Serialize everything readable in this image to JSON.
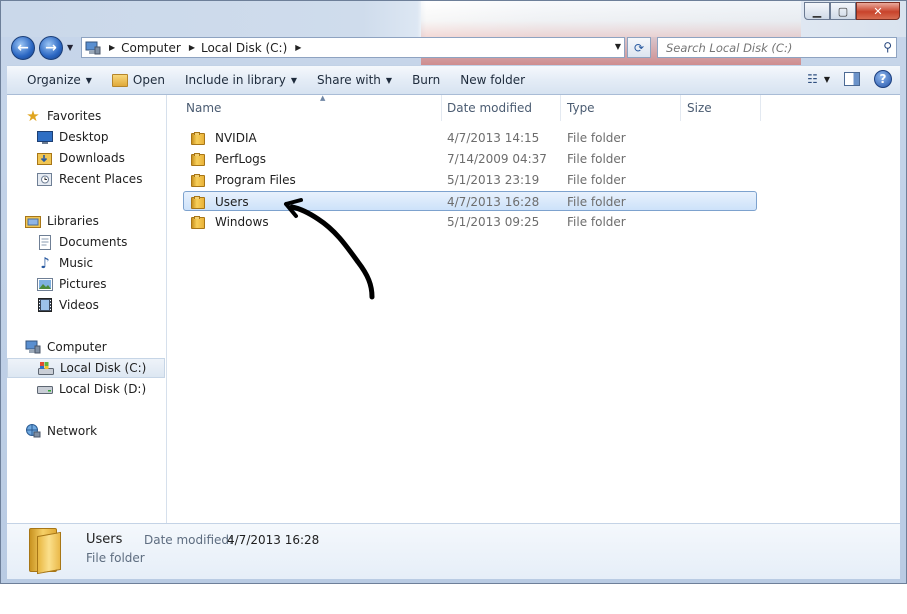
{
  "address": {
    "crumbs": [
      "Computer",
      "Local Disk (C:)"
    ]
  },
  "search": {
    "placeholder": "Search Local Disk (C:)"
  },
  "toolbar": {
    "organize": "Organize",
    "open": "Open",
    "include_in_library": "Include in library",
    "share_with": "Share with",
    "burn": "Burn",
    "new_folder": "New folder"
  },
  "nav": {
    "favorites": "Favorites",
    "desktop": "Desktop",
    "downloads": "Downloads",
    "recent_places": "Recent Places",
    "libraries": "Libraries",
    "documents": "Documents",
    "music": "Music",
    "pictures": "Pictures",
    "videos": "Videos",
    "computer": "Computer",
    "local_disk_c": "Local Disk (C:)",
    "local_disk_d": "Local Disk (D:)",
    "network": "Network"
  },
  "columns": {
    "name": "Name",
    "date_modified": "Date modified",
    "type": "Type",
    "size": "Size"
  },
  "files": [
    {
      "name": "NVIDIA",
      "date": "4/7/2013 14:15",
      "type": "File folder"
    },
    {
      "name": "PerfLogs",
      "date": "7/14/2009 04:37",
      "type": "File folder"
    },
    {
      "name": "Program Files",
      "date": "5/1/2013 23:19",
      "type": "File folder"
    },
    {
      "name": "Users",
      "date": "4/7/2013 16:28",
      "type": "File folder"
    },
    {
      "name": "Windows",
      "date": "5/1/2013 09:25",
      "type": "File folder"
    }
  ],
  "details": {
    "name": "Users",
    "type": "File folder",
    "date_label": "Date modified:",
    "date_value": "4/7/2013 16:28"
  },
  "colors": {
    "selection_bg": "#cde2fa",
    "selection_border": "#7da2ce",
    "toolbar_bg": "#e4ecf6"
  }
}
